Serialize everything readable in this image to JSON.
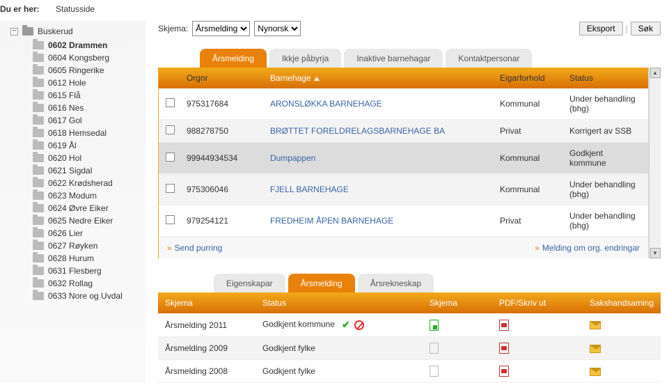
{
  "breadcrumb": {
    "you_are_here": "Du er her:",
    "page": "Statusside"
  },
  "tree": {
    "root": "Buskerud",
    "items": [
      "0602 Drammen",
      "0604 Kongsberg",
      "0605 Ringerike",
      "0612 Hole",
      "0615 Flå",
      "0616 Nes",
      "0617 Gol",
      "0618 Hemsedal",
      "0619 Ål",
      "0620 Hol",
      "0621 Sigdal",
      "0622 Krødsherad",
      "0623 Modum",
      "0624 Øvre Eiker",
      "0625 Nedre Eiker",
      "0626 Lier",
      "0627 Røyken",
      "0628 Hurum",
      "0631 Flesberg",
      "0632 Rollag",
      "0633 Nore og Uvdal"
    ]
  },
  "controls": {
    "skjema_label": "Skjema:",
    "skjema_value": "Årsmelding",
    "lang_value": "Nynorsk",
    "eksport": "Eksport",
    "sok": "Søk"
  },
  "tabs1": [
    "Årsmelding",
    "Ikkje påbyrja",
    "Inaktive barnehagar",
    "Kontaktpersonar"
  ],
  "grid1": {
    "headers": {
      "orgnr": "Orgnr",
      "barnehage": "Barnehage",
      "eigarforhold": "Eigarforhold",
      "status": "Status"
    },
    "rows": [
      {
        "org": "975317684",
        "bhg": "ARONSLØKKA BARNEHAGE",
        "eig": "Kommunal",
        "st": "Under behandling (bhg)"
      },
      {
        "org": "988278750",
        "bhg": "BRØTTET FORELDRELAGSBARNEHAGE BA",
        "eig": "Privat",
        "st": "Korrigert av SSB"
      },
      {
        "org": "99944934534",
        "bhg": "Dumpappen",
        "eig": "Kommunal",
        "st": "Godkjent kommune"
      },
      {
        "org": "975306046",
        "bhg": "FJELL BARNEHAGE",
        "eig": "Kommunal",
        "st": "Under behandling (bhg)"
      },
      {
        "org": "979254121",
        "bhg": "FREDHEIM ÅPEN BARNEHAGE",
        "eig": "Privat",
        "st": "Under behandling (bhg)"
      }
    ],
    "footer_left": "Send purring",
    "footer_right": "Melding om org. endringar"
  },
  "tabs2": [
    "Eigenskapar",
    "Årsmelding",
    "Årsrekneskap"
  ],
  "grid2": {
    "headers": {
      "skjema": "Skjema",
      "status": "Status",
      "skjema2": "Skjema",
      "pdf": "PDF/Skriv ut",
      "saks": "Sakshandsaming"
    },
    "rows": [
      {
        "skjema": "Årsmelding 2011",
        "status": "Godkjent kommune",
        "approved": true
      },
      {
        "skjema": "Årsmelding 2009",
        "status": "Godkjent fylke",
        "approved": false
      },
      {
        "skjema": "Årsmelding 2008",
        "status": "Godkjent fylke",
        "approved": false
      }
    ]
  }
}
